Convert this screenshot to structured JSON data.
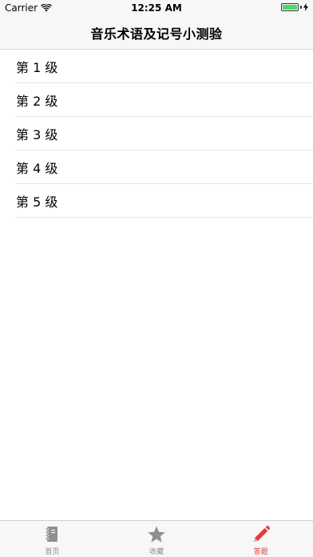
{
  "status_bar": {
    "carrier": "Carrier",
    "time": "12:25 AM",
    "battery_color": "#4cd964"
  },
  "nav": {
    "title": "音乐术语及记号小测验"
  },
  "levels": [
    {
      "label": "第 1 级"
    },
    {
      "label": "第 2 级"
    },
    {
      "label": "第 3 级"
    },
    {
      "label": "第 4 级"
    },
    {
      "label": "第 5 级"
    }
  ],
  "tabs": [
    {
      "label": "首页",
      "icon": "notebook-icon",
      "active": false
    },
    {
      "label": "收藏",
      "icon": "star-icon",
      "active": false
    },
    {
      "label": "答题",
      "icon": "pencil-icon",
      "active": true
    }
  ],
  "colors": {
    "active_tab": "#e83a3a",
    "inactive_tab": "#8e8e93"
  }
}
